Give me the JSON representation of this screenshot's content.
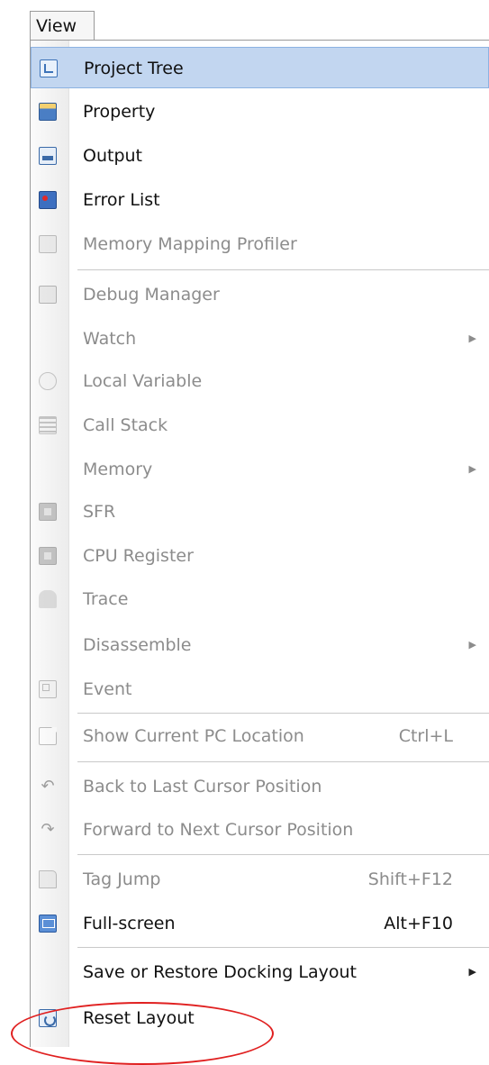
{
  "menubar": {
    "title": "View"
  },
  "items": [
    {
      "key": "project_tree",
      "label": "Project Tree",
      "shortcut": "",
      "submenu": false,
      "enabled": true,
      "highlighted": true,
      "icon": "project-tree-icon"
    },
    {
      "key": "property",
      "label": "Property",
      "shortcut": "",
      "submenu": false,
      "enabled": true,
      "icon": "property-icon"
    },
    {
      "key": "output",
      "label": "Output",
      "shortcut": "",
      "submenu": false,
      "enabled": true,
      "icon": "output-icon"
    },
    {
      "key": "error_list",
      "label": "Error List",
      "shortcut": "",
      "submenu": false,
      "enabled": true,
      "icon": "error-list-icon"
    },
    {
      "key": "memory_mapping_profiler",
      "label": "Memory Mapping Profiler",
      "shortcut": "",
      "submenu": false,
      "enabled": false,
      "icon": "memory-mapping-icon"
    },
    {
      "key": "debug_manager",
      "label": "Debug Manager",
      "shortcut": "",
      "submenu": false,
      "enabled": false,
      "icon": "debug-manager-icon"
    },
    {
      "key": "watch",
      "label": "Watch",
      "shortcut": "",
      "submenu": true,
      "enabled": false,
      "icon": ""
    },
    {
      "key": "local_variable",
      "label": "Local Variable",
      "shortcut": "",
      "submenu": false,
      "enabled": false,
      "icon": "local-variable-icon"
    },
    {
      "key": "call_stack",
      "label": "Call Stack",
      "shortcut": "",
      "submenu": false,
      "enabled": false,
      "icon": "call-stack-icon"
    },
    {
      "key": "memory",
      "label": "Memory",
      "shortcut": "",
      "submenu": true,
      "enabled": false,
      "icon": ""
    },
    {
      "key": "sfr",
      "label": "SFR",
      "shortcut": "",
      "submenu": false,
      "enabled": false,
      "icon": "sfr-icon"
    },
    {
      "key": "cpu_register",
      "label": "CPU Register",
      "shortcut": "",
      "submenu": false,
      "enabled": false,
      "icon": "cpu-register-icon"
    },
    {
      "key": "trace",
      "label": "Trace",
      "shortcut": "",
      "submenu": false,
      "enabled": false,
      "icon": "trace-icon"
    },
    {
      "key": "disassemble",
      "label": "Disassemble",
      "shortcut": "",
      "submenu": true,
      "enabled": false,
      "icon": ""
    },
    {
      "key": "event",
      "label": "Event",
      "shortcut": "",
      "submenu": false,
      "enabled": false,
      "icon": "event-icon"
    },
    {
      "key": "show_current_pc",
      "label": "Show Current PC Location",
      "shortcut": "Ctrl+L",
      "submenu": false,
      "enabled": false,
      "icon": "pc-location-icon"
    },
    {
      "key": "back_cursor",
      "label": "Back to Last Cursor Position",
      "shortcut": "",
      "submenu": false,
      "enabled": false,
      "icon": "back-arrow-icon"
    },
    {
      "key": "forward_cursor",
      "label": "Forward to Next Cursor Position",
      "shortcut": "",
      "submenu": false,
      "enabled": false,
      "icon": "forward-arrow-icon"
    },
    {
      "key": "tag_jump",
      "label": "Tag Jump",
      "shortcut": "Shift+F12",
      "submenu": false,
      "enabled": false,
      "icon": "tag-jump-icon"
    },
    {
      "key": "full_screen",
      "label": "Full-screen",
      "shortcut": "Alt+F10",
      "submenu": false,
      "enabled": true,
      "icon": "full-screen-icon"
    },
    {
      "key": "save_restore_docking",
      "label": "Save or Restore Docking Layout",
      "shortcut": "",
      "submenu": true,
      "enabled": true,
      "icon": ""
    },
    {
      "key": "reset_layout",
      "label": "Reset Layout",
      "shortcut": "",
      "submenu": false,
      "enabled": true,
      "icon": "reset-layout-icon"
    }
  ],
  "annotation": {
    "color": "#e02020"
  }
}
